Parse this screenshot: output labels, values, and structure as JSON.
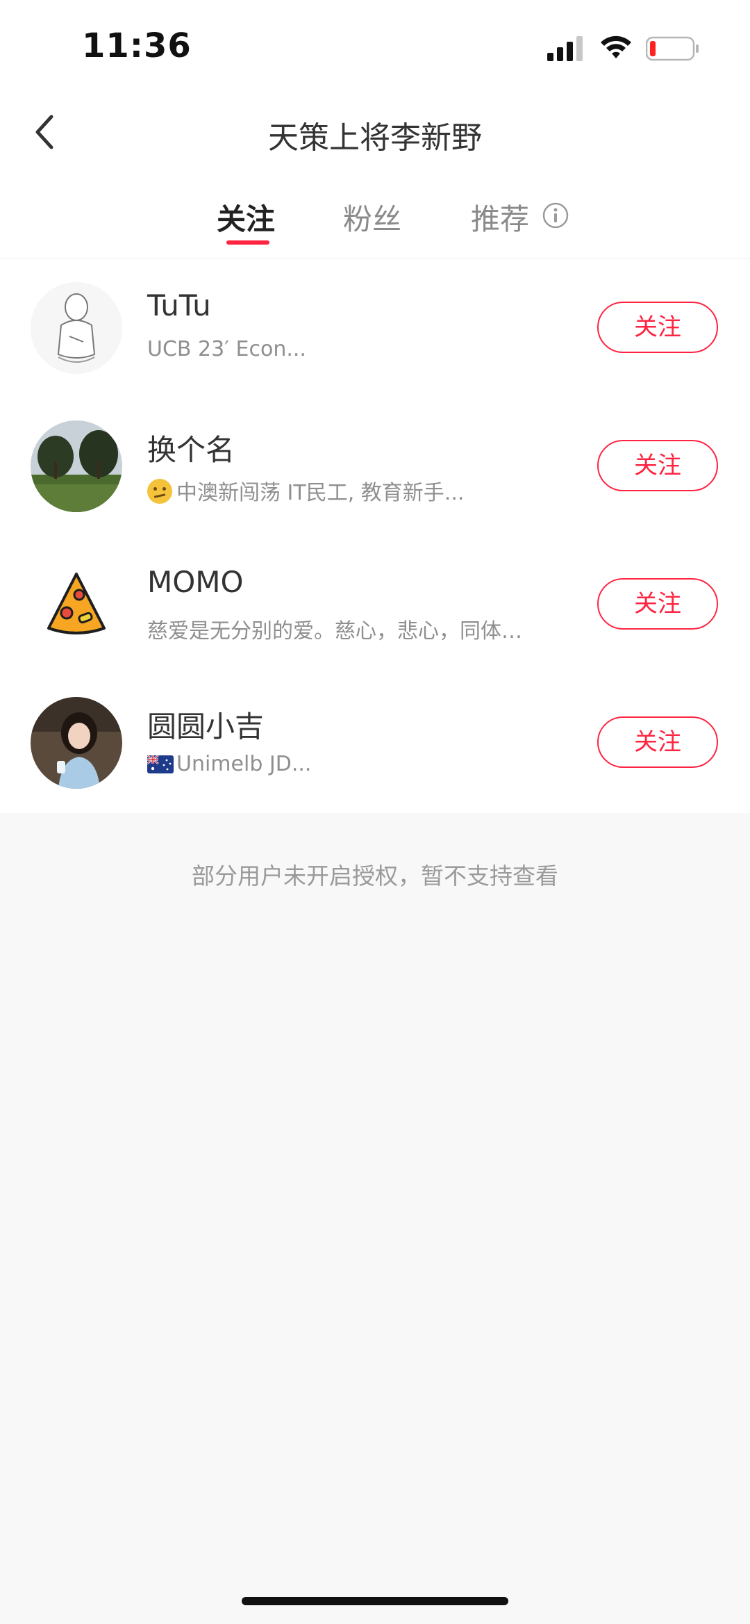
{
  "status_bar": {
    "time": "11:36",
    "icons": [
      "cellular-signal-icon",
      "wifi-icon",
      "battery-low-icon"
    ]
  },
  "header": {
    "title": "天策上将李新野",
    "back_icon": "chevron-left-icon"
  },
  "tabs": [
    {
      "label": "关注",
      "active": true
    },
    {
      "label": "粉丝",
      "active": false
    },
    {
      "label": "推荐",
      "active": false,
      "icon": "info-icon"
    }
  ],
  "accent_color": "#ff2442",
  "list": [
    {
      "name": "TuTu",
      "desc": "UCB 23′ Econ...",
      "button": "关注"
    },
    {
      "name": "换个名",
      "desc": "中澳新闯荡 IT民工, 教育新手...",
      "desc_emoji": "face-with-raised-eyebrow",
      "button": "关注"
    },
    {
      "name": "MOMO",
      "desc": "慈爱是无分别的爱。慈心，悲心，同体…",
      "button": "关注"
    },
    {
      "name": "圆圆小吉",
      "desc": "Unimelb JD...",
      "desc_emoji": "australia-flag",
      "button": "关注"
    }
  ],
  "footer_note": "部分用户未开启授权，暂不支持查看"
}
